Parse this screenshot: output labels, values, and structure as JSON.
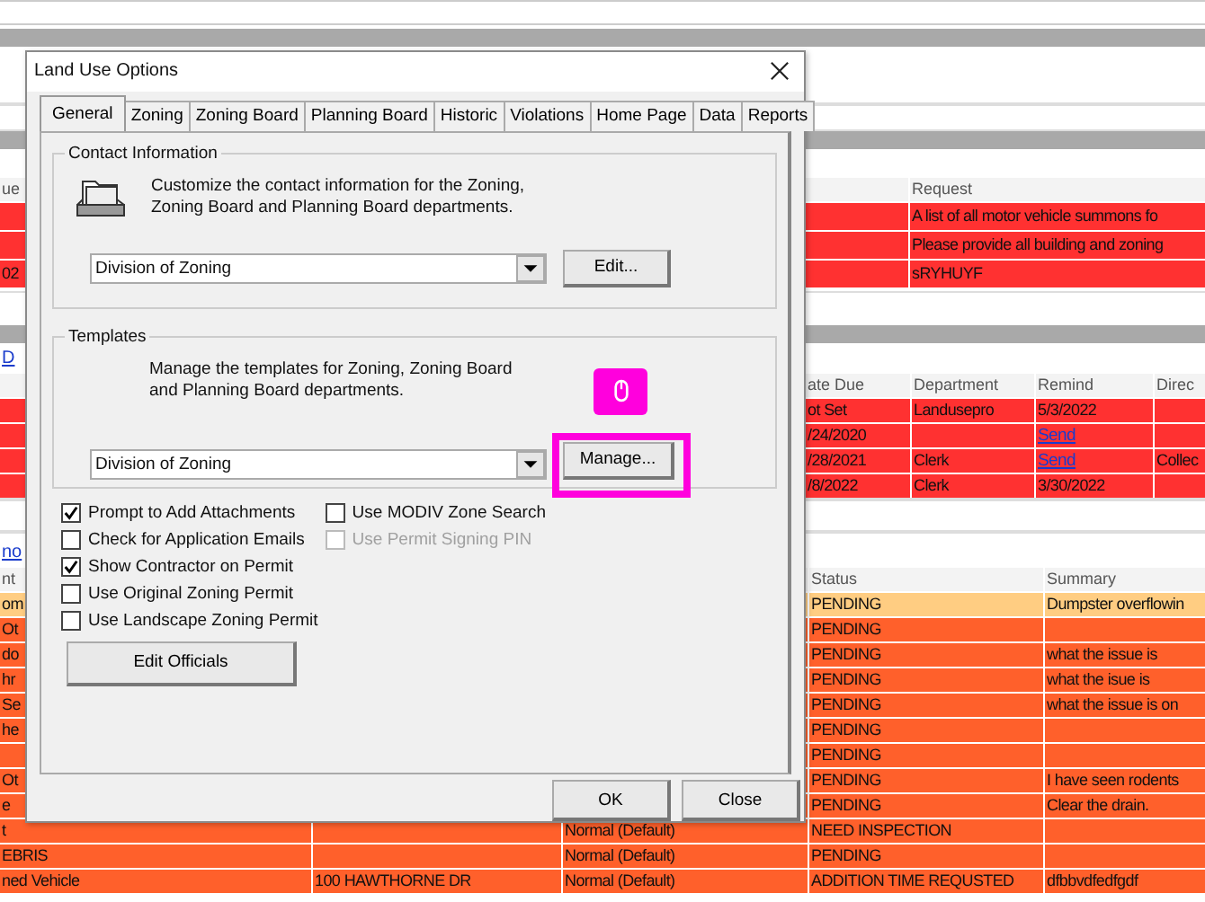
{
  "requests_table": {
    "columns": [
      "ue",
      "Request"
    ],
    "rows": [
      {
        "request": "A list of all motor vehicle summons fo"
      },
      {
        "request": "Please provide all building and zoning"
      },
      {
        "col_1": "02",
        "request": "sRYHUYF"
      }
    ]
  },
  "tasks_table": {
    "link": "D",
    "columns": [
      "ate Due",
      "Department",
      "Remind",
      "Direc"
    ],
    "rows": [
      {
        "due": "ot Set",
        "department": "Landusepro",
        "remind": {
          "kind": "text",
          "text": "5/3/2022"
        }
      },
      {
        "due": "/24/2020",
        "remind": {
          "kind": "link",
          "text": "Send"
        }
      },
      {
        "due": "/28/2021",
        "department": "Clerk",
        "remind": {
          "kind": "link",
          "text": "Send"
        },
        "direct": "Collec"
      },
      {
        "due": "/8/2022",
        "department": "Clerk",
        "remind": {
          "kind": "text",
          "text": "3/30/2022"
        }
      }
    ]
  },
  "complaints_table": {
    "link": "no",
    "columns": [
      "nt",
      "Status",
      "Summary"
    ],
    "rows": [
      {
        "selected": true,
        "col_1": "om",
        "status": "PENDING",
        "summary": "Dumpster overflowin"
      },
      {
        "selected": false,
        "col_1": "Ot",
        "status": "PENDING"
      },
      {
        "selected": false,
        "col_1": "do",
        "status": "PENDING",
        "summary": "what the issue is"
      },
      {
        "selected": false,
        "col_1": "hr",
        "status": "PENDING",
        "summary": "what the isue is"
      },
      {
        "selected": false,
        "col_1": "Se",
        "status": "PENDING",
        "summary": "what the issue is on"
      },
      {
        "selected": false,
        "col_1": "he",
        "status": "PENDING"
      },
      {
        "selected": false,
        "status": "PENDING"
      },
      {
        "selected": false,
        "col_1": "Ot",
        "status": "PENDING",
        "summary": "I have seen rodents"
      },
      {
        "selected": false,
        "col_1": "e",
        "status": "PENDING",
        "summary": "Clear the drain."
      },
      {
        "selected": false,
        "col_1": "t",
        "priority": "Normal (Default)",
        "status": "NEED INSPECTION"
      },
      {
        "selected": false,
        "col_1": "EBRIS",
        "priority": "Normal (Default)",
        "status": "PENDING"
      },
      {
        "selected": false,
        "col_1": "ned Vehicle",
        "address": "100 HAWTHORNE DR",
        "priority": "Normal (Default)",
        "status": "ADDITION TIME REQUSTED",
        "summary": "dfbbvdfedfgdf"
      }
    ]
  },
  "dialog": {
    "title": "Land Use Options",
    "tabs": [
      {
        "label": "General",
        "selected": true
      },
      {
        "label": "Zoning",
        "selected": false
      },
      {
        "label": "Zoning Board",
        "selected": false
      },
      {
        "label": "Planning Board",
        "selected": false
      },
      {
        "label": "Historic",
        "selected": false
      },
      {
        "label": "Violations",
        "selected": false
      },
      {
        "label": "Home Page",
        "selected": false
      },
      {
        "label": "Data",
        "selected": false
      },
      {
        "label": "Reports",
        "selected": false
      }
    ],
    "contact_group": {
      "title": "Contact Information",
      "description": "Customize the contact information for the Zoning, Zoning Board and Planning Board departments.",
      "dropdown": "Division of Zoning",
      "button": "Edit..."
    },
    "templates_group": {
      "title": "Templates",
      "description": "Manage the templates for Zoning, Zoning Board and Planning Board departments.",
      "dropdown": "Division of Zoning",
      "button": "Manage..."
    },
    "options_left": [
      {
        "label": "Prompt to Add Attachments",
        "checked": true,
        "disabled": false
      },
      {
        "label": "Check for Application Emails",
        "checked": false,
        "disabled": false
      },
      {
        "label": "Show Contractor on Permit",
        "checked": true,
        "disabled": false
      },
      {
        "label": "Use Original Zoning Permit",
        "checked": false,
        "disabled": false
      },
      {
        "label": "Use Landscape Zoning Permit",
        "checked": false,
        "disabled": false
      }
    ],
    "options_right": [
      {
        "label": "Use MODIV Zone Search",
        "checked": false,
        "disabled": false
      },
      {
        "label": "Use Permit Signing PIN",
        "checked": false,
        "disabled": true
      }
    ],
    "officials_button": "Edit Officials",
    "buttons": [
      "OK",
      "Close"
    ]
  }
}
